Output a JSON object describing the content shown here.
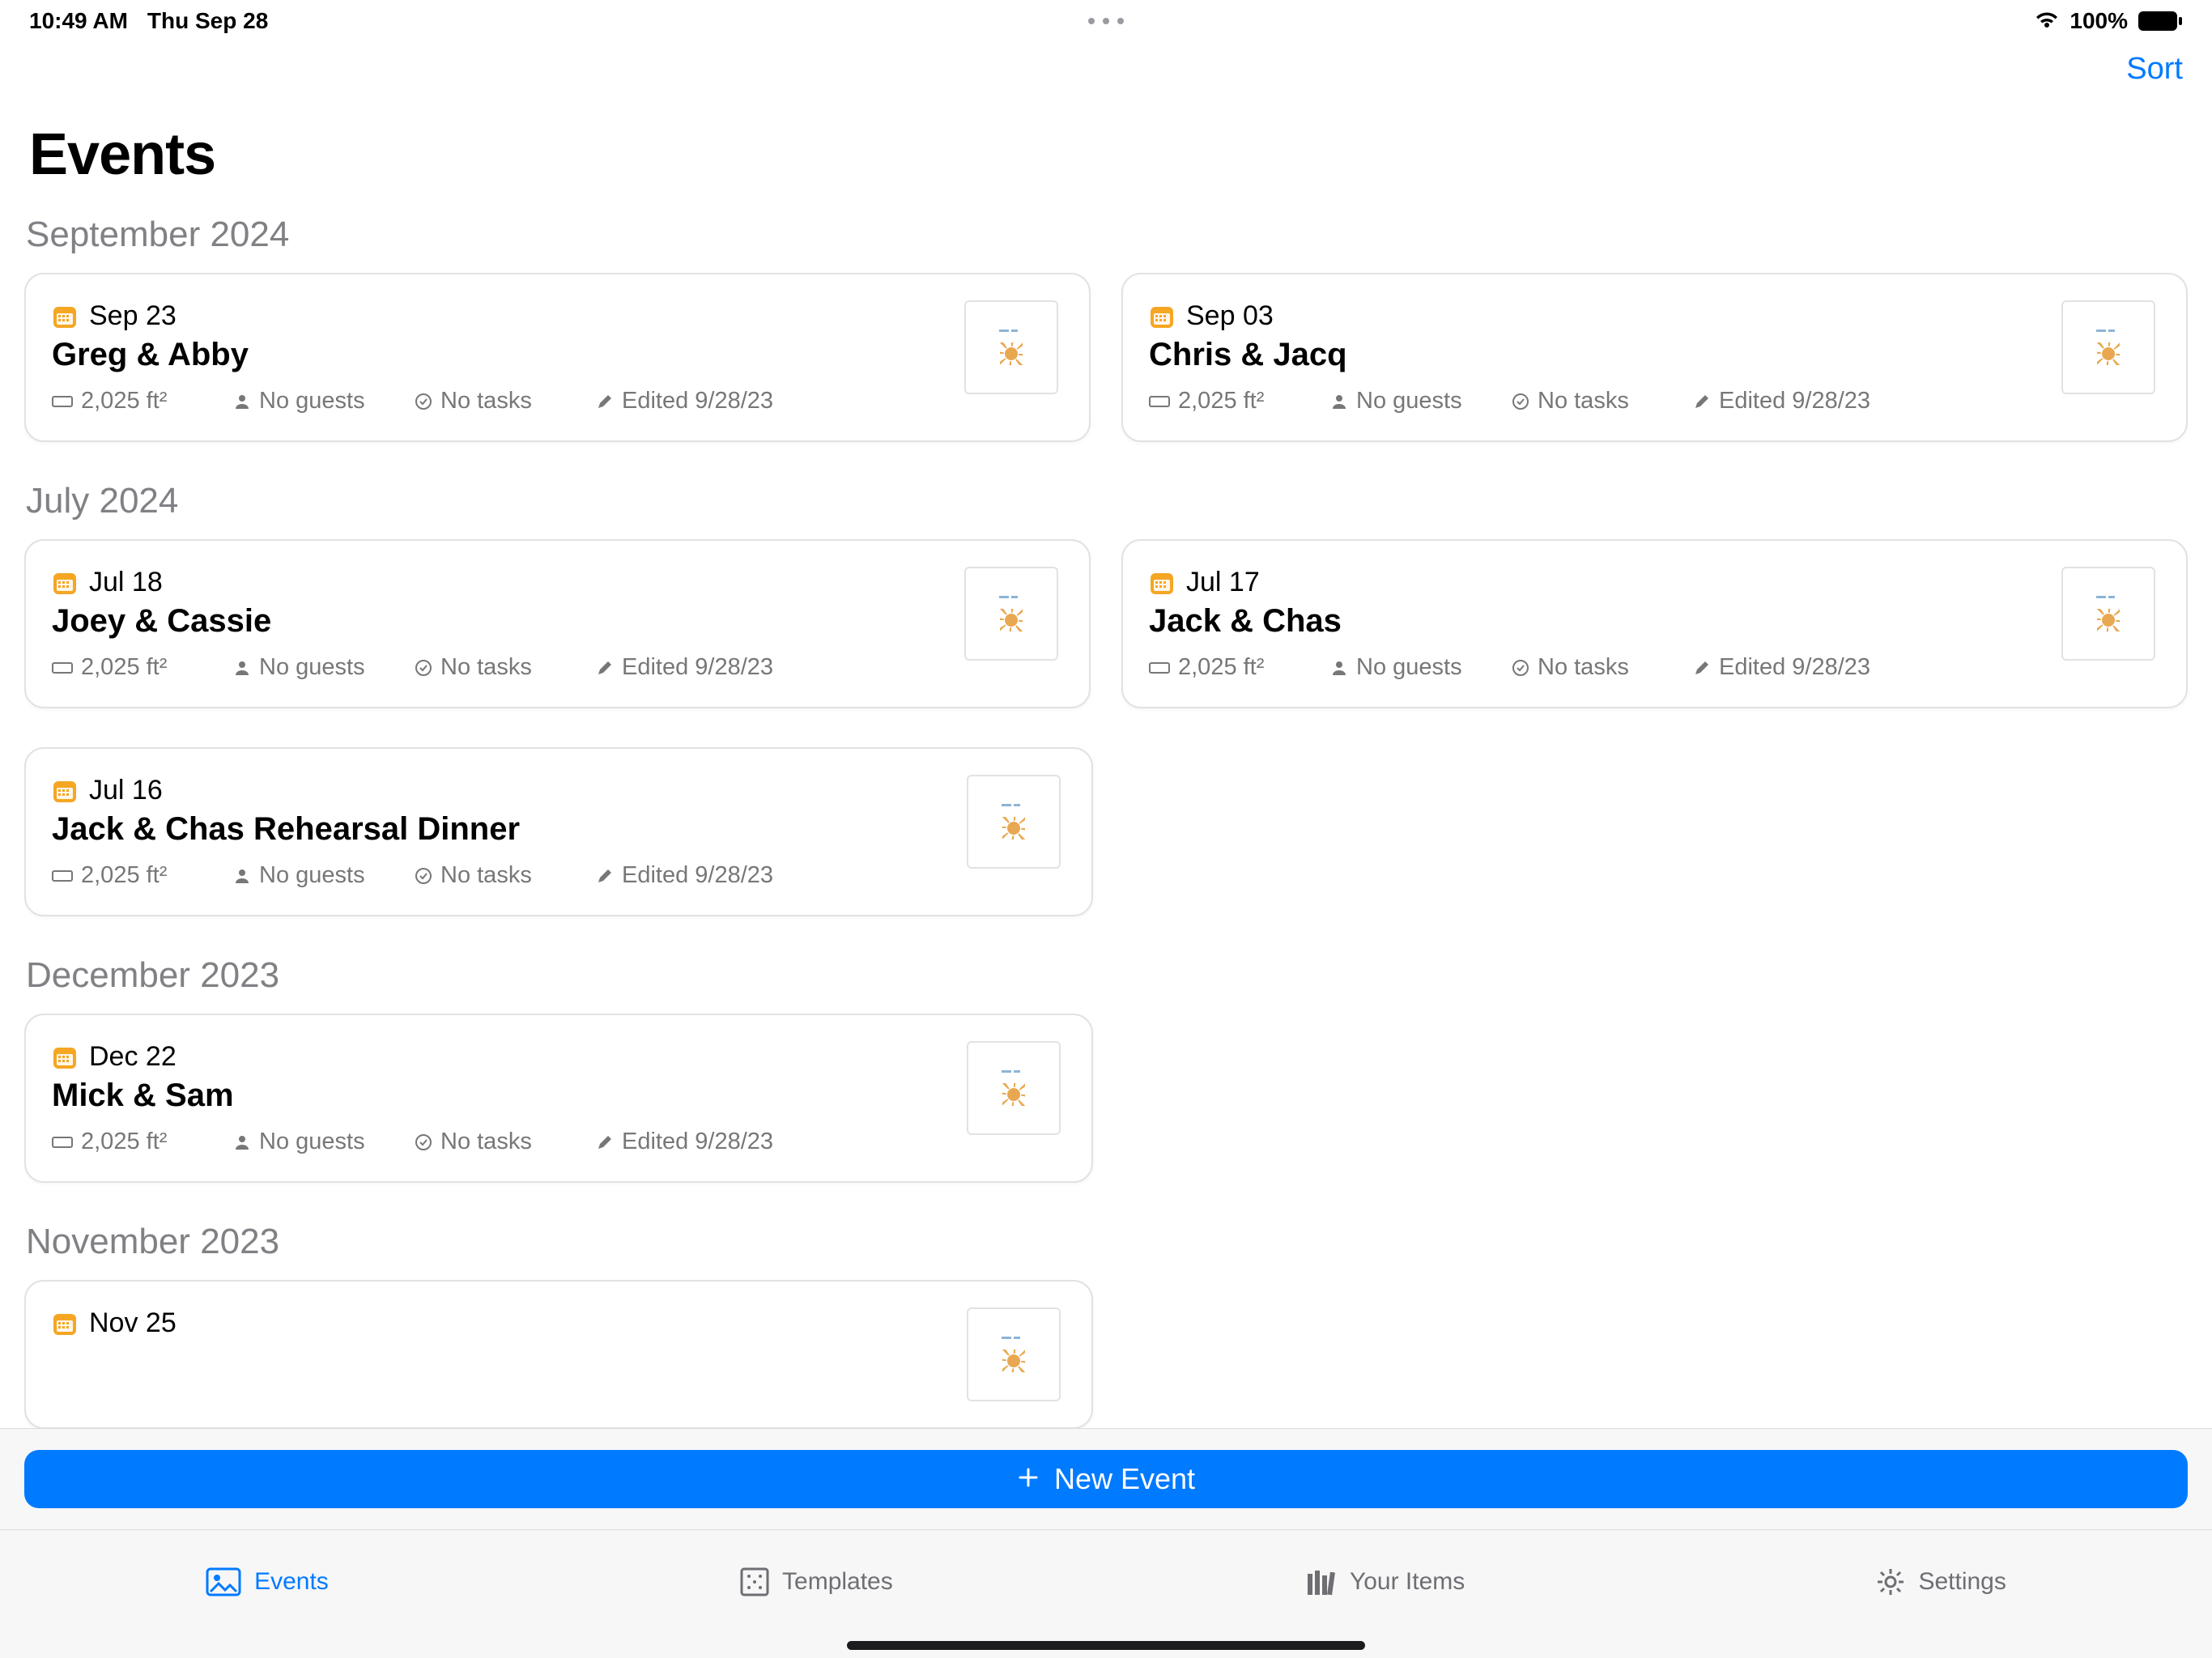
{
  "status": {
    "time": "10:49 AM",
    "date": "Thu Sep 28",
    "battery_pct": "100%"
  },
  "header": {
    "sort_label": "Sort",
    "page_title": "Events"
  },
  "new_event_label": "New Event",
  "tabs": {
    "events": "Events",
    "templates": "Templates",
    "items": "Your Items",
    "settings": "Settings"
  },
  "colors": {
    "accent": "#007aff",
    "calendar_icon": "#f5a623"
  },
  "sections": [
    {
      "title": "September 2024",
      "events": [
        {
          "date": "Sep 23",
          "name": "Greg & Abby",
          "area": "2,025 ft²",
          "guests": "No guests",
          "tasks": "No tasks",
          "edited": "Edited 9/28/23"
        },
        {
          "date": "Sep 03",
          "name": "Chris & Jacq",
          "area": "2,025 ft²",
          "guests": "No guests",
          "tasks": "No tasks",
          "edited": "Edited 9/28/23"
        }
      ]
    },
    {
      "title": "July 2024",
      "events": [
        {
          "date": "Jul 18",
          "name": "Joey & Cassie",
          "area": "2,025 ft²",
          "guests": "No guests",
          "tasks": "No tasks",
          "edited": "Edited 9/28/23"
        },
        {
          "date": "Jul 17",
          "name": "Jack & Chas",
          "area": "2,025 ft²",
          "guests": "No guests",
          "tasks": "No tasks",
          "edited": "Edited 9/28/23"
        },
        {
          "date": "Jul 16",
          "name": "Jack & Chas Rehearsal Dinner",
          "area": "2,025 ft²",
          "guests": "No guests",
          "tasks": "No tasks",
          "edited": "Edited 9/28/23"
        }
      ]
    },
    {
      "title": "December 2023",
      "events": [
        {
          "date": "Dec 22",
          "name": "Mick & Sam",
          "area": "2,025 ft²",
          "guests": "No guests",
          "tasks": "No tasks",
          "edited": "Edited 9/28/23"
        }
      ]
    },
    {
      "title": "November 2023",
      "events": [
        {
          "date": "Nov 25",
          "name": "",
          "area": "",
          "guests": "",
          "tasks": "",
          "edited": ""
        }
      ]
    }
  ]
}
